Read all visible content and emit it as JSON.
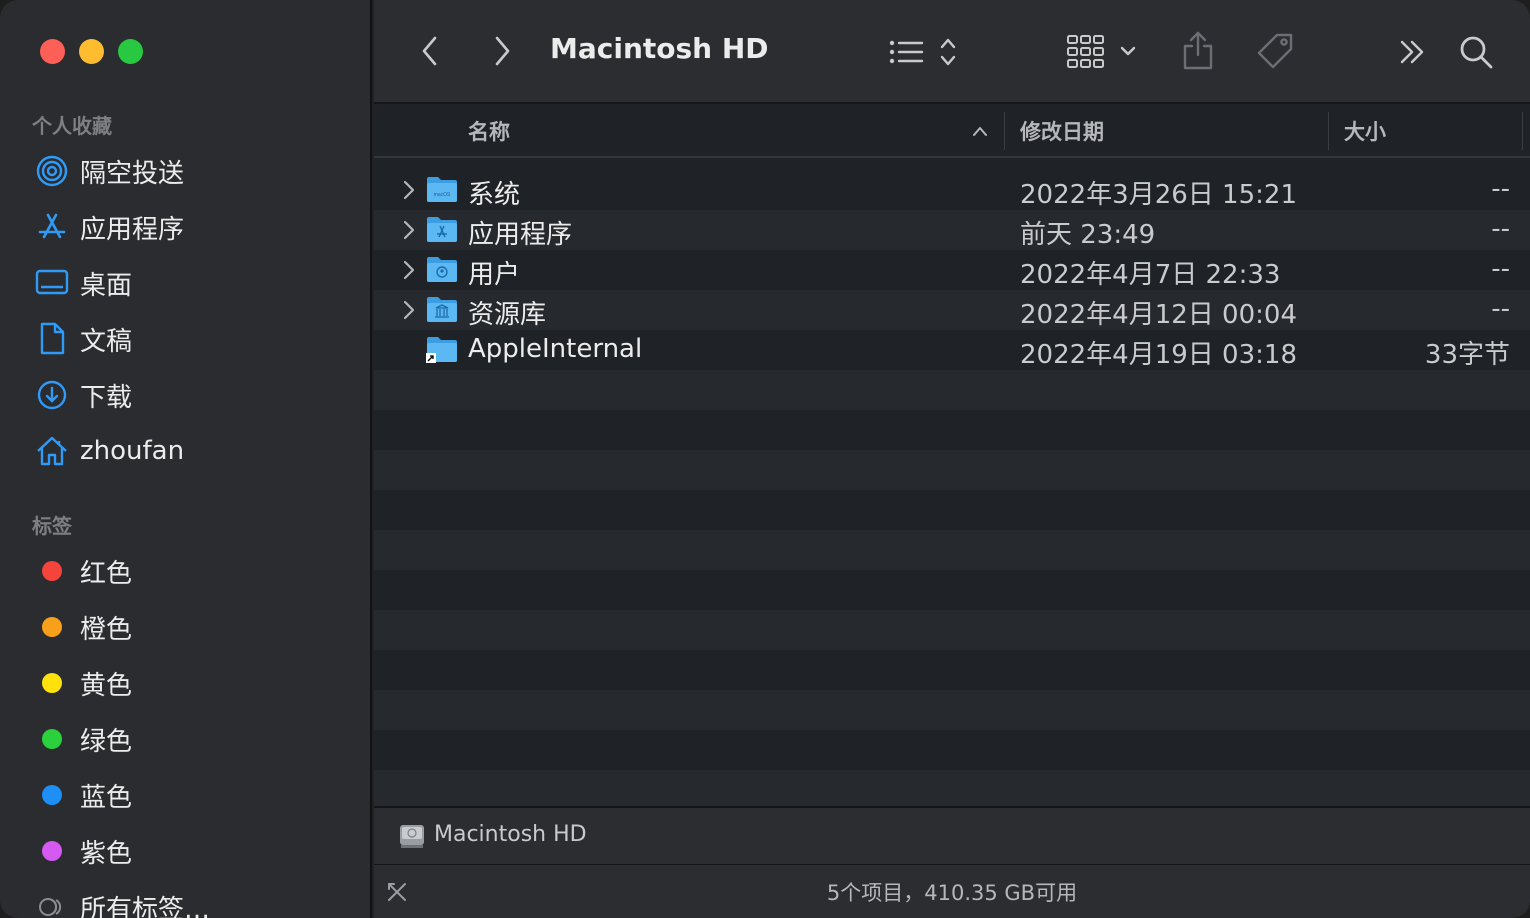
{
  "window": {
    "title": "Macintosh HD"
  },
  "sidebar": {
    "favorites_title": "个人收藏",
    "favorites": [
      {
        "label": "隔空投送",
        "icon": "airdrop-icon"
      },
      {
        "label": "应用程序",
        "icon": "applications-icon"
      },
      {
        "label": "桌面",
        "icon": "desktop-icon"
      },
      {
        "label": "文稿",
        "icon": "document-icon"
      },
      {
        "label": "下载",
        "icon": "download-icon"
      },
      {
        "label": "zhoufan",
        "icon": "home-icon"
      }
    ],
    "tags_title": "标签",
    "tags": [
      {
        "label": "红色",
        "color": "#f5443c"
      },
      {
        "label": "橙色",
        "color": "#f9a01b"
      },
      {
        "label": "黄色",
        "color": "#ffe20c"
      },
      {
        "label": "绿色",
        "color": "#2bd13d"
      },
      {
        "label": "蓝色",
        "color": "#1d8ff5"
      },
      {
        "label": "紫色",
        "color": "#d55af2"
      },
      {
        "label": "所有标签…",
        "icon": "all-tags-icon"
      }
    ]
  },
  "columns": {
    "name": "名称",
    "date": "修改日期",
    "size": "大小"
  },
  "files": [
    {
      "name": "系统",
      "date": "2022年3月26日 15:21",
      "size": "--",
      "expandable": true,
      "icon": "system-folder-icon"
    },
    {
      "name": "应用程序",
      "date": "前天 23:49",
      "size": "--",
      "expandable": true,
      "icon": "applications-folder-icon"
    },
    {
      "name": "用户",
      "date": "2022年4月7日 22:33",
      "size": "--",
      "expandable": true,
      "icon": "users-folder-icon"
    },
    {
      "name": "资源库",
      "date": "2022年4月12日 00:04",
      "size": "--",
      "expandable": true,
      "icon": "library-folder-icon"
    },
    {
      "name": "AppleInternal",
      "date": "2022年4月19日 03:18",
      "size": "33字节",
      "expandable": false,
      "icon": "alias-folder-icon"
    }
  ],
  "pathbar": {
    "label": "Macintosh HD"
  },
  "status": {
    "text": "5个项目，410.35 GB可用"
  },
  "colors": {
    "accent": "#2f9bf6",
    "folder": "#54b3f0"
  }
}
